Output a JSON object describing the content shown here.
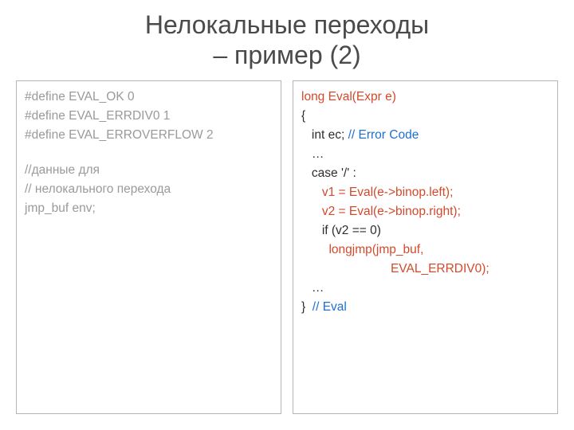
{
  "slide": {
    "title_line1": "Нелокальные переходы",
    "title_line2": "– пример (2)"
  },
  "left": {
    "l1": "#define EVAL_OK 0",
    "l2": "#define EVAL_ERRDIV0 1",
    "l3": "#define EVAL_ERROVERFLOW 2",
    "l4": "//данные для",
    "l5": "// нелокального перехода",
    "l6": "jmp_buf env;"
  },
  "right": {
    "r1": "long Eval(Expr e)",
    "r2": "{",
    "r3a": "   int ec; ",
    "r3b": "// Error Code",
    "r4": "   …",
    "r5": "   case '/' :",
    "r6": "      v1 = Eval(e->binop.left);",
    "r7": "      v2 = Eval(e->binop.right);",
    "r8": "      if (v2 == 0)",
    "r9": "        longjmp(jmp_buf,",
    "r10": "                          EVAL_ERRDIV0);",
    "r11": "   …",
    "r12a": "}  ",
    "r12b": "// Eval"
  }
}
